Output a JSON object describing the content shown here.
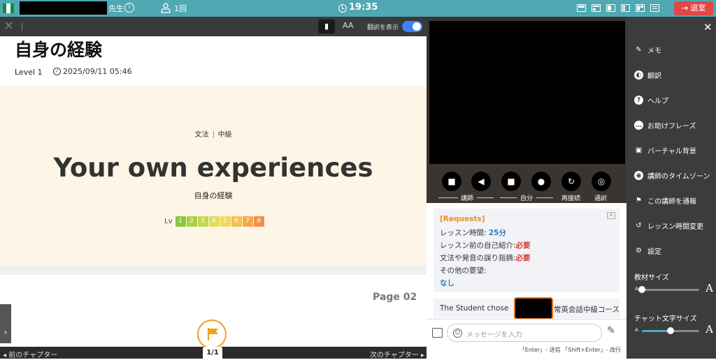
{
  "topbar": {
    "teacher_suffix": "先生",
    "info_icon": "info-icon",
    "lesson_count": "1回",
    "time": "19:35",
    "exit_label": "退室",
    "accent": "#4fa8b2",
    "exit_color": "#e04848"
  },
  "toolbar": {
    "translate_label": "翻訳を表示",
    "font_size_label": "AA",
    "translate_enabled": true
  },
  "document": {
    "title": "自身の経験",
    "level": "Level 1",
    "date": "2025/09/11 05:46",
    "category": "文法",
    "difficulty": "中級",
    "cover_title": "Your own experiences",
    "cover_subtitle": "自身の経験",
    "lv_label": "Lv",
    "lv_levels": [
      "1",
      "2",
      "3",
      "4",
      "5",
      "6",
      "7",
      "8"
    ],
    "lv_colors": [
      "#8cc63e",
      "#a8d046",
      "#c4d84e",
      "#dfdf58",
      "#f2d85a",
      "#f4c054",
      "#f2a84e",
      "#f09048"
    ],
    "page_label": "Page 02",
    "prev_chapter": "前のチャプター",
    "next_chapter": "次のチャプター",
    "page_indicator": "1/1"
  },
  "video": {
    "controls": [
      "camera-teacher",
      "speaker-teacher",
      "camera-self",
      "mic-self",
      "reconnect",
      "call"
    ],
    "teacher_label": "講師",
    "self_label": "自分",
    "reconnect_label": "再接続",
    "call_label": "通訳"
  },
  "requests": {
    "header": "[Requests]",
    "lesson_time_label": "レッスン時間: ",
    "lesson_time_value": "25分",
    "intro_label": "レッスン前の自己紹介:",
    "intro_value": "必要",
    "correction_label": "文法や発音の誤り指摘:",
    "correction_value": "必要",
    "other_label": "その他の要望:",
    "other_value": "なし"
  },
  "chat": {
    "student_prefix": "The Student chose ",
    "student_suffix": "常英会話中級コース",
    "placeholder": "メッセージを入力",
    "hint": "「Enter」- 送信 「Shift+Enter」- 改行"
  },
  "side_menu": {
    "items": [
      {
        "label": "メモ",
        "icon": "memo-icon"
      },
      {
        "label": "翻訳",
        "icon": "translate-icon"
      },
      {
        "label": "ヘルプ",
        "icon": "help-icon"
      },
      {
        "label": "お助けフレーズ",
        "icon": "phrase-icon"
      },
      {
        "label": "バーチャル背景",
        "icon": "image-icon"
      },
      {
        "label": "講師のタイムゾーン",
        "icon": "globe-icon"
      },
      {
        "label": "この講師を通報",
        "icon": "flag-icon"
      },
      {
        "label": "レッスン時間変更",
        "icon": "history-icon"
      },
      {
        "label": "設定",
        "icon": "gear-icon"
      }
    ],
    "material_size_label": "教材サイズ",
    "material_size_value": 0,
    "chat_font_label": "チャット文字サイズ",
    "chat_font_value": 0.5,
    "small_a": "A",
    "big_a": "A"
  }
}
